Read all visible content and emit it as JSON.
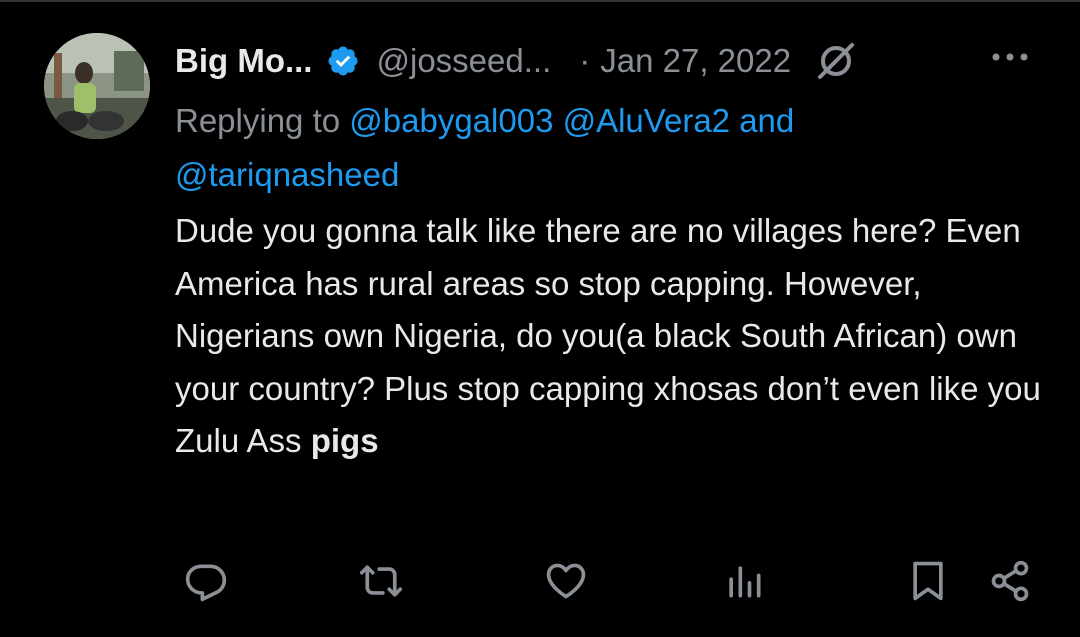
{
  "tweet": {
    "author_name": "Big Mo...",
    "handle": "@josseed...",
    "separator": "·",
    "date": "Jan 27, 2022",
    "replying_prefix": "Replying to ",
    "mentions": [
      "@babygal003",
      "@AluVera2"
    ],
    "and_text": " and",
    "mention_last": "@tariqnasheed",
    "text_plain": "Dude you gonna talk like there are no villages here? Even America has rural areas so stop capping. However, Nigerians own Nigeria, do you(a black South African) own your country? Plus stop capping xhosas don’t even like you Zulu Ass ",
    "text_bold": "pigs"
  },
  "icons": {
    "verified": "verified-badge-icon",
    "grok": "grok-icon",
    "more": "more-options-icon",
    "reply": "reply-icon",
    "retweet": "retweet-icon",
    "like": "like-icon",
    "views": "views-icon",
    "bookmark": "bookmark-icon",
    "share": "share-icon"
  },
  "colors": {
    "background": "#000000",
    "text": "#e7e9ea",
    "secondary": "#8b9096",
    "link": "#1d9bf0",
    "verified": "#1d9bf0"
  }
}
